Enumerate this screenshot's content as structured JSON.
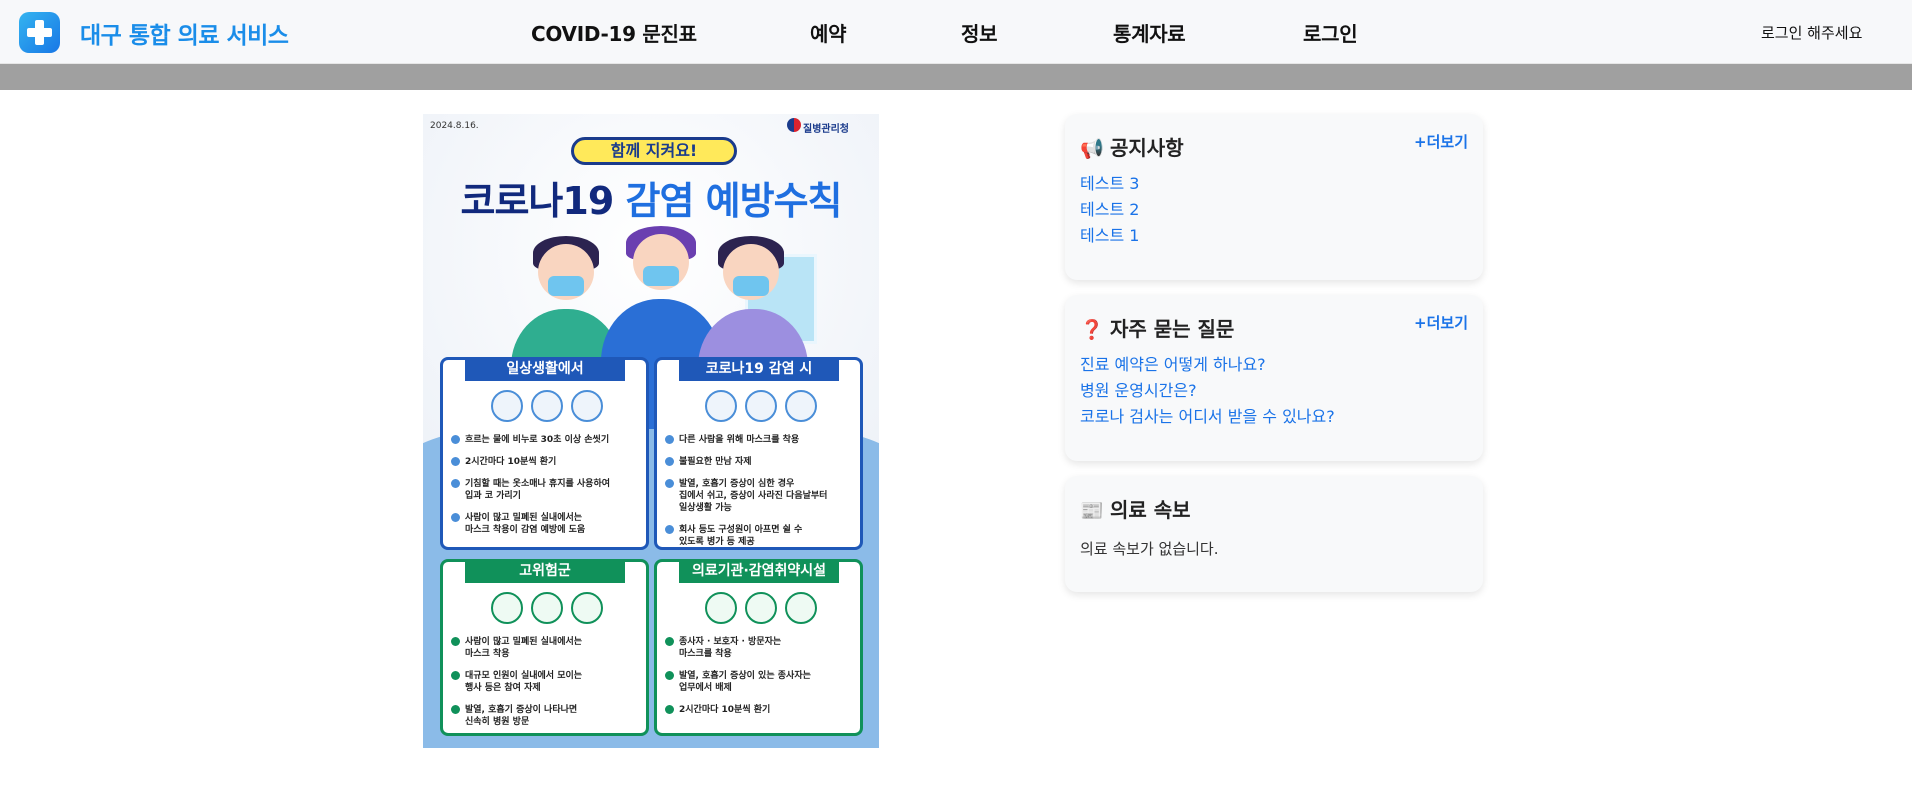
{
  "header": {
    "brand": "대구 통합 의료 서비스",
    "logo_icon": "medical-cross-icon",
    "nav": [
      "COVID-19 문진표",
      "예약",
      "정보",
      "통계자료",
      "로그인"
    ],
    "login_hint": "로그인 해주세요"
  },
  "poster": {
    "date": "2024.8.16.",
    "agency": "질병관리청",
    "bubble": "함께 지켜요!",
    "title_main": "코로나19 ",
    "title_highlight": "감염 예방수칙",
    "sections": [
      {
        "heading": "일상생활에서",
        "rules": [
          "흐르는 물에 비누로 30초 이상 손씻기",
          "2시간마다 10분씩 환기",
          "기침할 때는 옷소매나 휴지를 사용하여\n입과 코 가리기",
          "사람이 많고 밀폐된 실내에서는\n마스크 착용이 감염 예방에 도움"
        ]
      },
      {
        "heading": "코로나19 감염 시",
        "rules": [
          "다른 사람을 위해 마스크를 착용",
          "불필요한 만남 자제",
          "발열, 호흡기 증상이 심한 경우\n집에서 쉬고, 증상이 사라진 다음날부터\n일상생활 가능",
          "회사 등도 구성원이 아프면 쉴 수\n있도록 병가 등 제공"
        ]
      },
      {
        "heading": "고위험군",
        "rules": [
          "사람이 많고 밀폐된 실내에서는\n마스크 착용",
          "대규모 인원이 실내에서 모이는\n행사 등은 참여 자제",
          "발열, 호흡기 증상이 나타나면\n신속히 병원 방문"
        ]
      },
      {
        "heading": "의료기관·감염취약시설",
        "rules": [
          "종사자 · 보호자 · 방문자는\n마스크를 착용",
          "발열, 호흡기 증상이 있는 종사자는\n업무에서 배제",
          "2시간마다 10분씩 환기"
        ]
      }
    ]
  },
  "notice": {
    "title": "공지사항",
    "icon": "megaphone-icon",
    "more": "+더보기",
    "items": [
      "테스트 3",
      "테스트 2",
      "테스트 1"
    ]
  },
  "faq": {
    "title": "자주 묻는 질문",
    "icon": "question-mark-icon",
    "more": "+더보기",
    "items": [
      "진료 예약은 어떻게 하나요?",
      "병원 운영시간은?",
      "코로나 검사는 어디서 받을 수 있나요?"
    ]
  },
  "news": {
    "title": "의료 속보",
    "icon": "newspaper-icon",
    "empty": "의료 속보가 없습니다."
  },
  "colors": {
    "brand": "#1a8de9",
    "link": "#1a73e8",
    "header_bg": "#f7f8fa",
    "grey_bar": "#a0a0a0",
    "card_bg": "#f8f9fa"
  }
}
